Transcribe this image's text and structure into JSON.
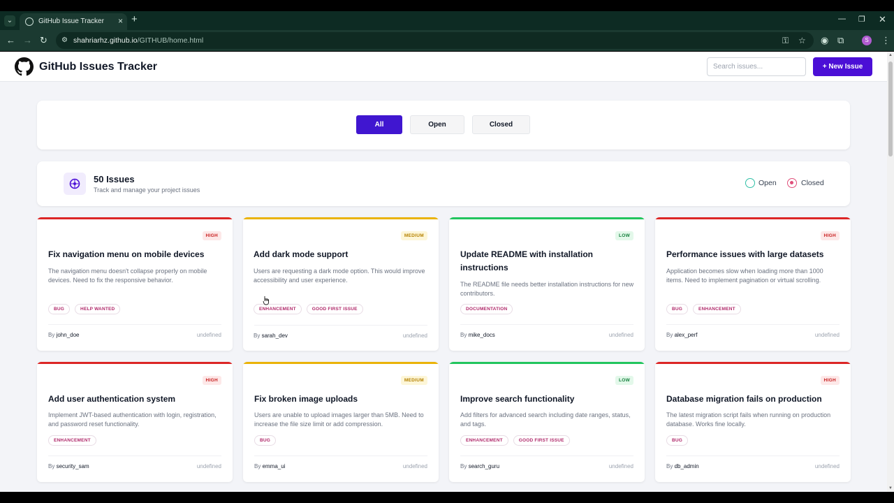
{
  "browser": {
    "tab_title": "GitHub Issue Tracker",
    "url_host": "shahriarhz.github.io",
    "url_path": "/GITHUB/home.html",
    "profile_initial": "S"
  },
  "header": {
    "title": "GitHub Issues Tracker",
    "search_placeholder": "Search issues...",
    "new_issue_label": "+ New Issue"
  },
  "filters": {
    "all": "All",
    "open": "Open",
    "closed": "Closed"
  },
  "stats": {
    "count": "50 Issues",
    "subtitle": "Track and manage your project issues",
    "legend_open": "Open",
    "legend_closed": "Closed"
  },
  "colors": {
    "accent": "#4b0fd6",
    "high": "#dc2626",
    "medium": "#eab308",
    "low": "#22c55e"
  },
  "issues": [
    {
      "priority": "HIGH",
      "title": "Fix navigation menu on mobile devices",
      "desc": "The navigation menu doesn't collapse properly on mobile devices. Need to fix the responsive behavior.",
      "labels": [
        "BUG",
        "HELP WANTED"
      ],
      "author": "john_doe",
      "date": "undefined"
    },
    {
      "priority": "MEDIUM",
      "title": "Add dark mode support",
      "desc": "Users are requesting a dark mode option. This would improve accessibility and user experience.",
      "labels": [
        "ENHANCEMENT",
        "GOOD FIRST ISSUE"
      ],
      "author": "sarah_dev",
      "date": "undefined"
    },
    {
      "priority": "LOW",
      "title": "Update README with installation instructions",
      "desc": "The README file needs better installation instructions for new contributors.",
      "labels": [
        "DOCUMENTATION"
      ],
      "author": "mike_docs",
      "date": "undefined"
    },
    {
      "priority": "HIGH",
      "title": "Performance issues with large datasets",
      "desc": "Application becomes slow when loading more than 1000 items. Need to implement pagination or virtual scrolling.",
      "labels": [
        "BUG",
        "ENHANCEMENT"
      ],
      "author": "alex_perf",
      "date": "undefined"
    },
    {
      "priority": "HIGH",
      "title": "Add user authentication system",
      "desc": "Implement JWT-based authentication with login, registration, and password reset functionality.",
      "labels": [
        "ENHANCEMENT"
      ],
      "author": "security_sam",
      "date": "undefined"
    },
    {
      "priority": "MEDIUM",
      "title": "Fix broken image uploads",
      "desc": "Users are unable to upload images larger than 5MB. Need to increase the file size limit or add compression.",
      "labels": [
        "BUG"
      ],
      "author": "emma_ui",
      "date": "undefined"
    },
    {
      "priority": "LOW",
      "title": "Improve search functionality",
      "desc": "Add filters for advanced search including date ranges, status, and tags.",
      "labels": [
        "ENHANCEMENT",
        "GOOD FIRST ISSUE"
      ],
      "author": "search_guru",
      "date": "undefined"
    },
    {
      "priority": "HIGH",
      "title": "Database migration fails on production",
      "desc": "The latest migration script fails when running on production database. Works fine locally.",
      "labels": [
        "BUG"
      ],
      "author": "db_admin",
      "date": "undefined"
    }
  ]
}
